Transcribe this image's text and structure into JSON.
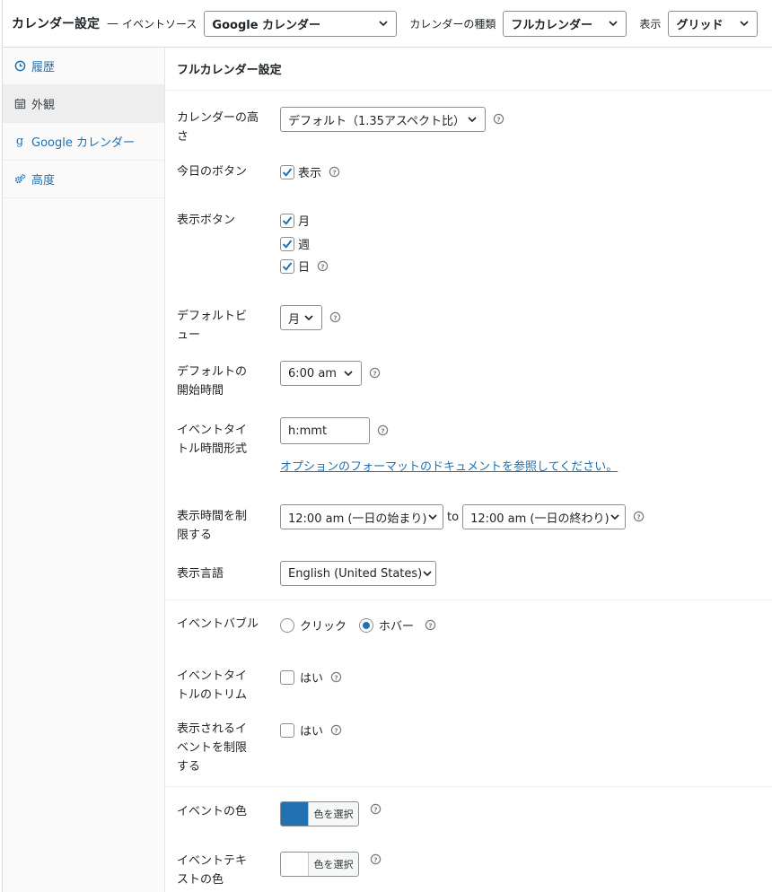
{
  "header": {
    "title": "カレンダー設定",
    "sep": "—",
    "source_label": "イベントソース",
    "source_value": "Google カレンダー",
    "type_label": "カレンダーの種類",
    "type_value": "フルカレンダー",
    "display_label": "表示",
    "display_value": "グリッド"
  },
  "sidebar": {
    "items": [
      {
        "label": "履歴",
        "icon": "clock-icon"
      },
      {
        "label": "外観",
        "icon": "calendar-icon"
      },
      {
        "label": "Google カレンダー",
        "icon": "google-g-icon"
      },
      {
        "label": "高度",
        "icon": "gears-icon"
      }
    ]
  },
  "panel": {
    "title": "フルカレンダー設定",
    "height": {
      "label": "カレンダーの高さ",
      "value": "デフォルト（1.35アスペクト比）"
    },
    "today_button": {
      "label": "今日のボタン",
      "option": "表示",
      "checked": true
    },
    "view_buttons": {
      "label": "表示ボタン",
      "options": [
        {
          "label": "月",
          "checked": true
        },
        {
          "label": "週",
          "checked": true
        },
        {
          "label": "日",
          "checked": true
        }
      ]
    },
    "default_view": {
      "label": "デフォルトビュー",
      "value": "月"
    },
    "default_start": {
      "label": "デフォルトの開始時間",
      "value": "6:00 am"
    },
    "event_title_time": {
      "label": "イベントタイトル時間形式",
      "value": "h:mmt",
      "link": "オプションのフォーマットのドキュメントを参照してください。"
    },
    "limit_time": {
      "label": "表示時間を制限する",
      "from": "12:00 am (一日の始まり)",
      "to_word": "to",
      "to": "12:00 am (一日の終わり)"
    },
    "language": {
      "label": "表示言語",
      "value": "English (United States)"
    },
    "event_bubble": {
      "label": "イベントバブル",
      "options": [
        {
          "label": "クリック",
          "selected": false
        },
        {
          "label": "ホバー",
          "selected": true
        }
      ]
    },
    "trim_title": {
      "label": "イベントタイトルのトリム",
      "option": "はい",
      "checked": false
    },
    "limit_events": {
      "label": "表示されるイベントを制限する",
      "option": "はい",
      "checked": false
    },
    "event_color": {
      "label": "イベントの色",
      "button": "色を選択",
      "color": "#2271b1"
    },
    "event_text_color": {
      "label": "イベントテキストの色",
      "button": "色を選択",
      "color": "#ffffff"
    }
  },
  "colors": {
    "accent": "#2271b1",
    "border": "#8c8f94",
    "sidebar_bg": "#fafafa",
    "sidebar_active": "#eeeeee"
  }
}
